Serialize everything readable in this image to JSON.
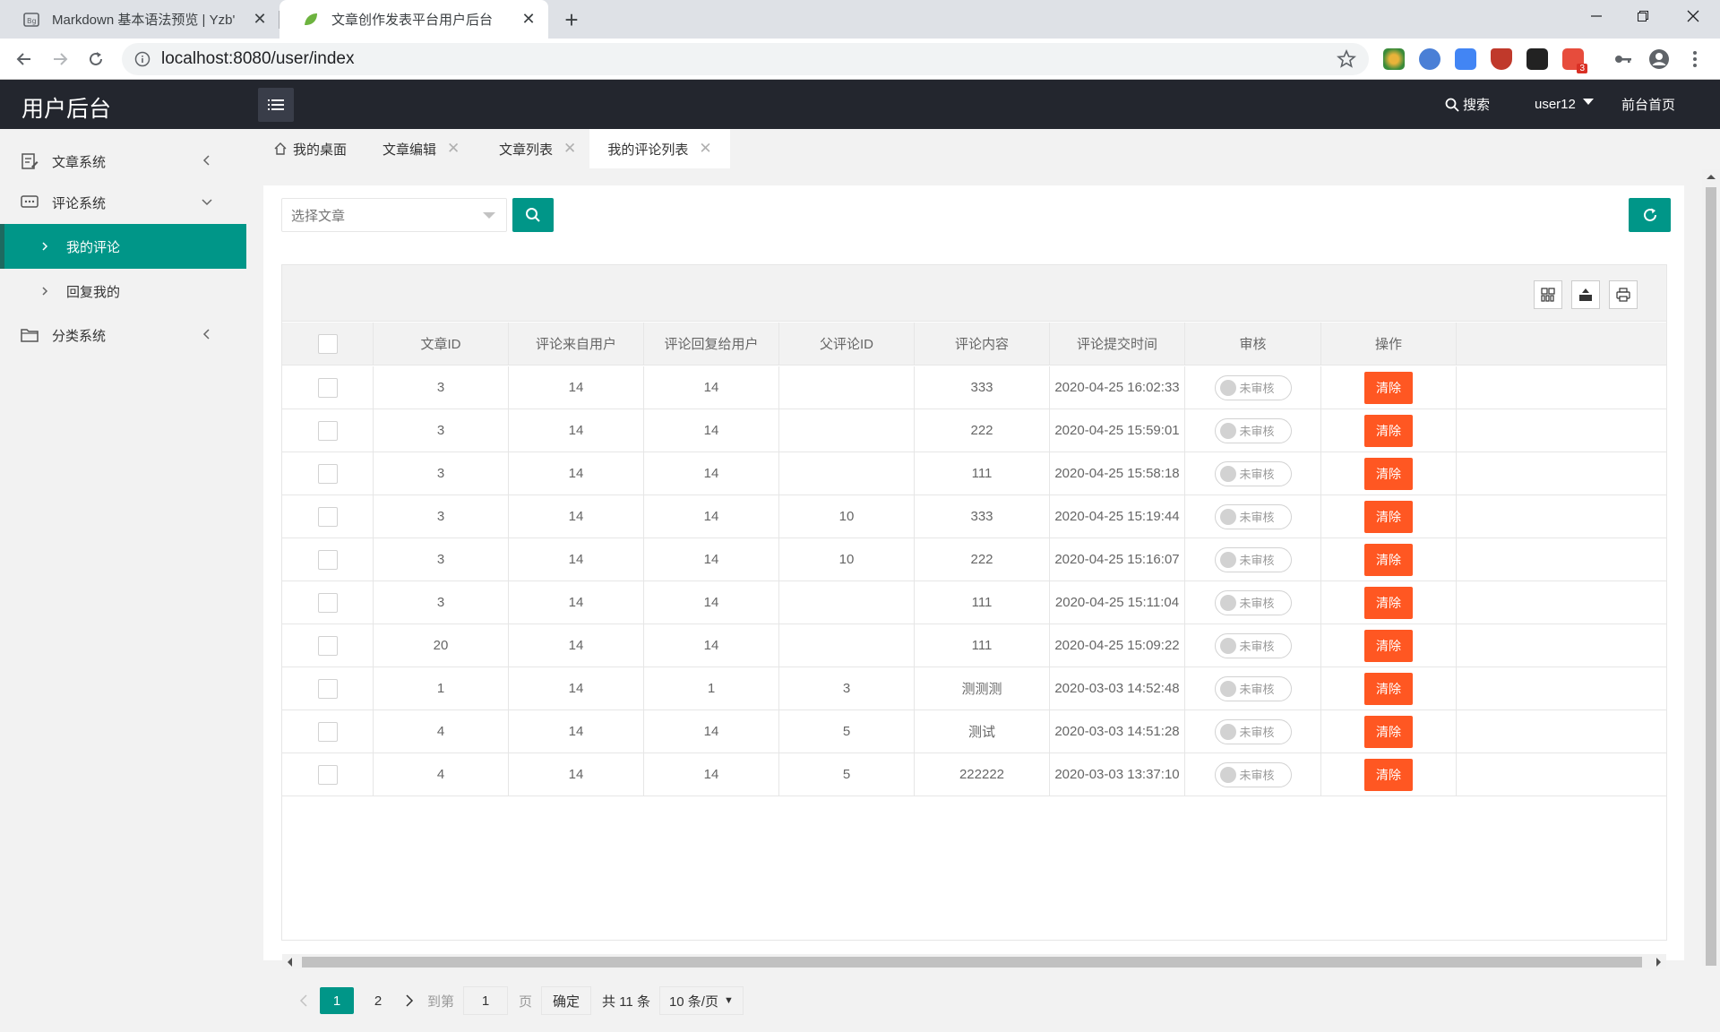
{
  "browser": {
    "tabs": [
      {
        "title": "Markdown 基本语法预览 | Yzb' "
      },
      {
        "title": "文章创作发表平台用户后台"
      }
    ],
    "url": "localhost:8080/user/index",
    "ext_badge": "3"
  },
  "header": {
    "brand": "用户后台",
    "search": "搜索",
    "user": "user12",
    "home": "前台首页"
  },
  "sidebar": {
    "items": [
      {
        "label": "文章系统"
      },
      {
        "label": "评论系统"
      },
      {
        "label": "我的评论"
      },
      {
        "label": "回复我的"
      },
      {
        "label": "分类系统"
      }
    ]
  },
  "pagetabs": [
    "我的桌面",
    "文章编辑",
    "文章列表",
    "我的评论列表"
  ],
  "filter": {
    "placeholder": "选择文章"
  },
  "table": {
    "columns": [
      "文章ID",
      "评论来自用户",
      "评论回复给用户",
      "父评论ID",
      "评论内容",
      "评论提交时间",
      "审核",
      "操作"
    ],
    "status_label": "未审核",
    "action_label": "清除",
    "rows": [
      [
        "3",
        "14",
        "14",
        "",
        "333",
        "2020-04-25 16:02:33"
      ],
      [
        "3",
        "14",
        "14",
        "",
        "222",
        "2020-04-25 15:59:01"
      ],
      [
        "3",
        "14",
        "14",
        "",
        "111",
        "2020-04-25 15:58:18"
      ],
      [
        "3",
        "14",
        "14",
        "10",
        "333",
        "2020-04-25 15:19:44"
      ],
      [
        "3",
        "14",
        "14",
        "10",
        "222",
        "2020-04-25 15:16:07"
      ],
      [
        "3",
        "14",
        "14",
        "",
        "111",
        "2020-04-25 15:11:04"
      ],
      [
        "20",
        "14",
        "14",
        "",
        "111",
        "2020-04-25 15:09:22"
      ],
      [
        "1",
        "14",
        "1",
        "3",
        "测测测",
        "2020-03-03 14:52:48"
      ],
      [
        "4",
        "14",
        "14",
        "5",
        "测试",
        "2020-03-03 14:51:28"
      ],
      [
        "4",
        "14",
        "14",
        "5",
        "222222",
        "2020-03-03 13:37:10"
      ]
    ]
  },
  "pager": {
    "page1": "1",
    "page2": "2",
    "goto": "到第",
    "input": "1",
    "page_word": "页",
    "confirm": "确定",
    "total": "共 11 条",
    "limit": "10 条/页"
  },
  "colors": {
    "accent": "#009688",
    "danger": "#ff5722",
    "header": "#23262e"
  }
}
